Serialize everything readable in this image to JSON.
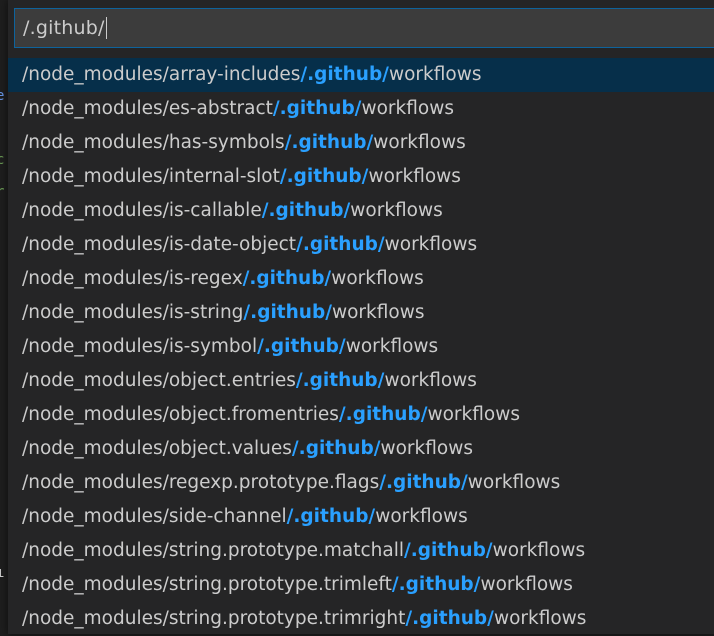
{
  "quick_open": {
    "input_value": "/.github/",
    "items": [
      {
        "prefix": "/node_modules/array-includes",
        "match": "/.github/",
        "suffix": "workflows"
      },
      {
        "prefix": "/node_modules/es-abstract",
        "match": "/.github/",
        "suffix": "workflows"
      },
      {
        "prefix": "/node_modules/has-symbols",
        "match": "/.github/",
        "suffix": "workflows"
      },
      {
        "prefix": "/node_modules/internal-slot",
        "match": "/.github/",
        "suffix": "workflows"
      },
      {
        "prefix": "/node_modules/is-callable",
        "match": "/.github/",
        "suffix": "workflows"
      },
      {
        "prefix": "/node_modules/is-date-object",
        "match": "/.github/",
        "suffix": "workflows"
      },
      {
        "prefix": "/node_modules/is-regex",
        "match": "/.github/",
        "suffix": "workflows"
      },
      {
        "prefix": "/node_modules/is-string",
        "match": "/.github/",
        "suffix": "workflows"
      },
      {
        "prefix": "/node_modules/is-symbol",
        "match": "/.github/",
        "suffix": "workflows"
      },
      {
        "prefix": "/node_modules/object.entries",
        "match": "/.github/",
        "suffix": "workflows"
      },
      {
        "prefix": "/node_modules/object.fromentries",
        "match": "/.github/",
        "suffix": "workflows"
      },
      {
        "prefix": "/node_modules/object.values",
        "match": "/.github/",
        "suffix": "workflows"
      },
      {
        "prefix": "/node_modules/regexp.prototype.flags",
        "match": "/.github/",
        "suffix": "workflows"
      },
      {
        "prefix": "/node_modules/side-channel",
        "match": "/.github/",
        "suffix": "workflows"
      },
      {
        "prefix": "/node_modules/string.prototype.matchall",
        "match": "/.github/",
        "suffix": "workflows"
      },
      {
        "prefix": "/node_modules/string.prototype.trimleft",
        "match": "/.github/",
        "suffix": "workflows"
      },
      {
        "prefix": "/node_modules/string.prototype.trimright",
        "match": "/.github/",
        "suffix": "workflows"
      }
    ]
  },
  "colors": {
    "background": "#252526",
    "input_border": "#0e639c",
    "selected_row": "#062f4a",
    "highlight": "#2aa0ff",
    "text": "#cccccc"
  }
}
